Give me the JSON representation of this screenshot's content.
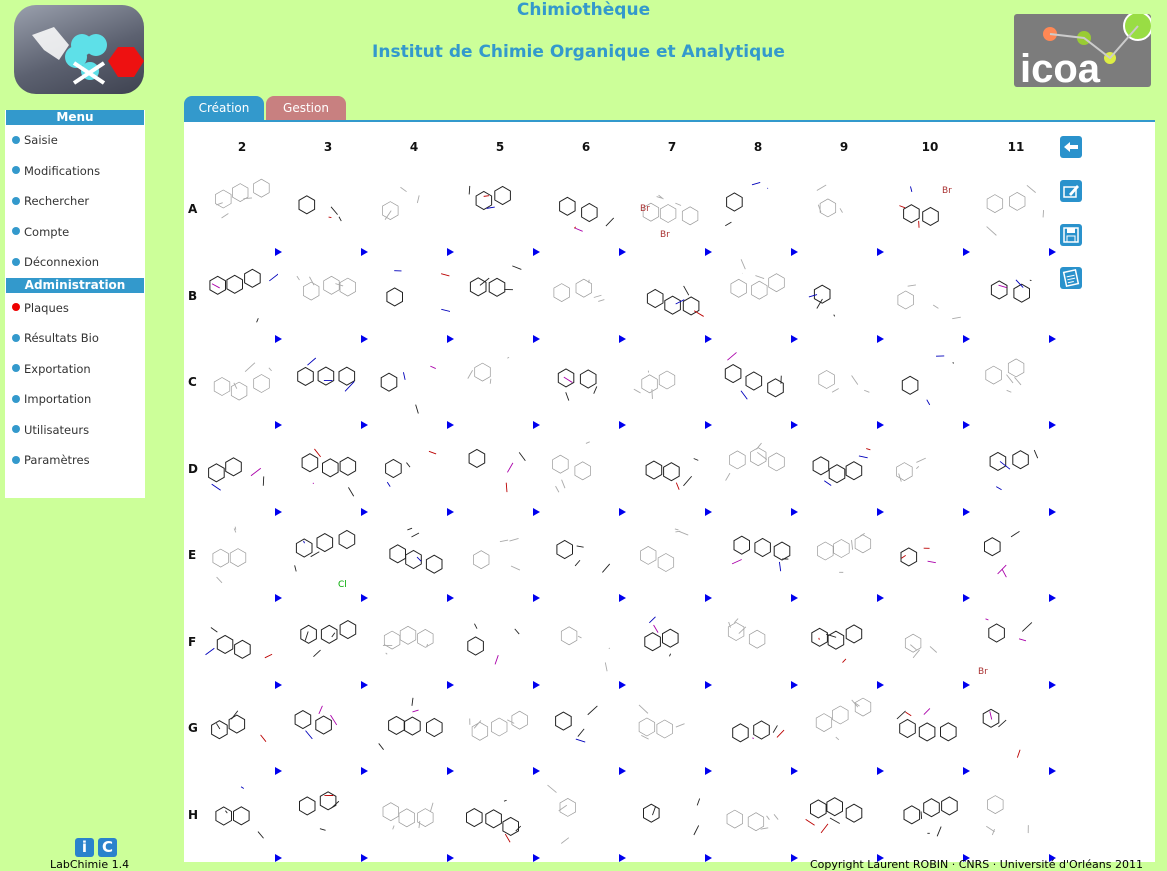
{
  "header": {
    "title": "Chimiothèque",
    "subtitle": "Institut de Chimie Organique et Analytique",
    "logo_right_text": "icoa"
  },
  "sidebar": {
    "menu_title": "Menu",
    "menu_items": [
      "Saisie",
      "Modifications",
      "Rechercher",
      "Compte",
      "Déconnexion"
    ],
    "admin_title": "Administration",
    "admin_items": [
      "Plaques",
      "Résultats Bio",
      "Exportation",
      "Importation",
      "Utilisateurs",
      "Paramètres"
    ],
    "active_item": "Plaques"
  },
  "tabs": [
    "Création",
    "Gestion"
  ],
  "plate": {
    "columns": [
      "2",
      "3",
      "4",
      "5",
      "6",
      "7",
      "8",
      "9",
      "10",
      "11"
    ],
    "rows": [
      "A",
      "B",
      "C",
      "D",
      "E",
      "F",
      "G",
      "H"
    ],
    "atom_labels": {
      "A6_top": "Br",
      "A6_bottom": "Br",
      "A9": "Br",
      "E2": "Cl",
      "F11": "Br"
    }
  },
  "toolbar": {
    "icons": [
      "back-arrow-icon",
      "edit-icon",
      "save-icon",
      "list-icon"
    ]
  },
  "footer": {
    "app_name": "LabChimie 1.4",
    "copyright": "Copyright Laurent ROBIN · CNRS · Université d'Orléans 2011"
  },
  "colors": {
    "background": "#ccff99",
    "accent": "#3399cc",
    "gestion_tab": "#c88080",
    "arrow": "#0000ee"
  }
}
